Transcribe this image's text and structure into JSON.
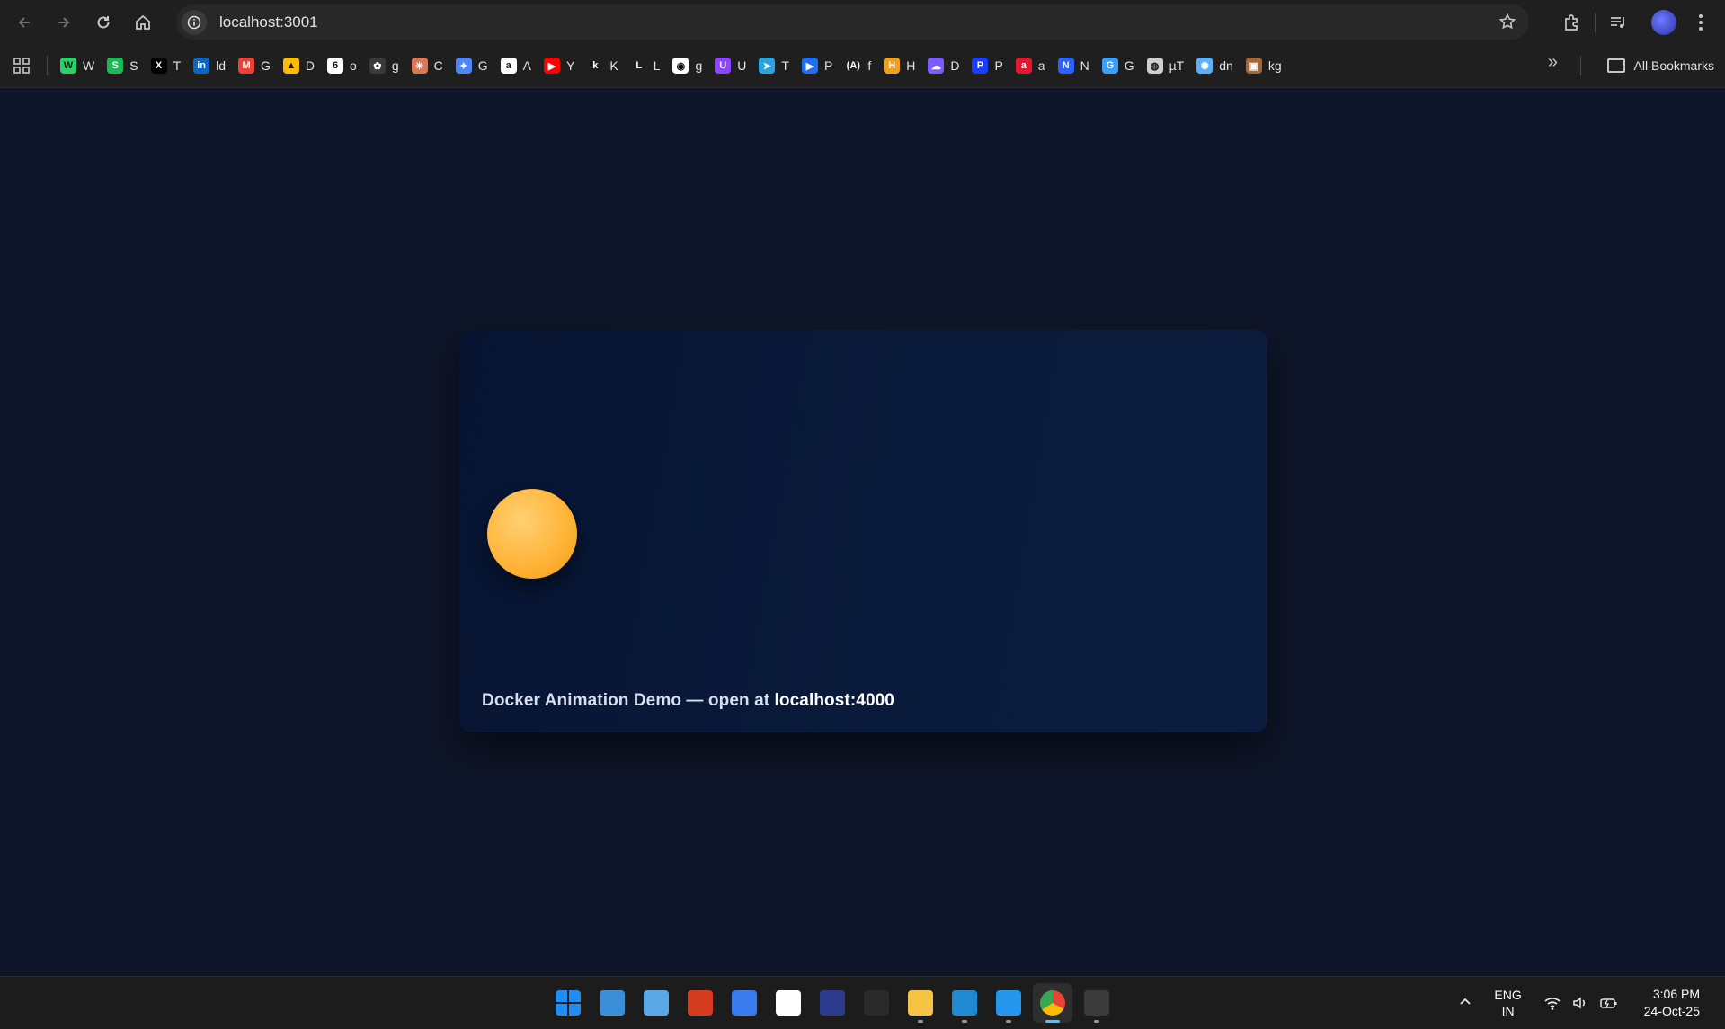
{
  "browser": {
    "url": "localhost:3001",
    "bookmarks": [
      {
        "label": "W",
        "icon": "whatsapp-icon",
        "color": "#25d366",
        "glyph": "W"
      },
      {
        "label": "S",
        "icon": "spotify-icon",
        "color": "#1db954",
        "glyph": "S"
      },
      {
        "label": "T",
        "icon": "x-twitter-icon",
        "color": "#000000",
        "glyph": "X"
      },
      {
        "label": "ld",
        "icon": "linkedin-icon",
        "color": "#0a66c2",
        "glyph": "in"
      },
      {
        "label": "G",
        "icon": "gmail-icon",
        "color": "#ea4335",
        "glyph": "M"
      },
      {
        "label": "D",
        "icon": "google-drive-icon",
        "color": "#fbbc04",
        "glyph": "▲"
      },
      {
        "label": "o",
        "icon": "six-icon",
        "color": "#ffffff",
        "glyph": "6"
      },
      {
        "label": "g",
        "icon": "openai-icon",
        "color": "#3a3a3a",
        "glyph": "✿"
      },
      {
        "label": "C",
        "icon": "claude-icon",
        "color": "#d97757",
        "glyph": "✳"
      },
      {
        "label": "G",
        "icon": "gemini-icon",
        "color": "#4f86f7",
        "glyph": "✦"
      },
      {
        "label": "A",
        "icon": "amazon-icon",
        "color": "#ffffff",
        "glyph": "a"
      },
      {
        "label": "Y",
        "icon": "youtube-icon",
        "color": "#ff0000",
        "glyph": "▶"
      },
      {
        "label": "K",
        "icon": "k-icon",
        "color": "#1f1f1f",
        "glyph": "k"
      },
      {
        "label": "L",
        "icon": "leetcode-icon",
        "color": "#1f1f1f",
        "glyph": "L"
      },
      {
        "label": "g",
        "icon": "github-icon",
        "color": "#ffffff",
        "glyph": "◉"
      },
      {
        "label": "U",
        "icon": "u-icon",
        "color": "#8e44ff",
        "glyph": "U"
      },
      {
        "label": "T",
        "icon": "telegram-icon",
        "color": "#2aa3df",
        "glyph": "➤"
      },
      {
        "label": "P",
        "icon": "play-icon",
        "color": "#1d6ff2",
        "glyph": "▶"
      },
      {
        "label": "f",
        "icon": "formula-icon",
        "color": "#1f1f1f",
        "glyph": "(A)"
      },
      {
        "label": "H",
        "icon": "h-icon",
        "color": "#f0a020",
        "glyph": "H"
      },
      {
        "label": "D",
        "icon": "cloud-icon",
        "color": "#7a5cff",
        "glyph": "☁"
      },
      {
        "label": "P",
        "icon": "p-icon",
        "color": "#1a3cff",
        "glyph": "P"
      },
      {
        "label": "a",
        "icon": "a-icon",
        "color": "#e0182d",
        "glyph": "a"
      },
      {
        "label": "N",
        "icon": "n-icon",
        "color": "#2b62ff",
        "glyph": "N"
      },
      {
        "label": "G",
        "icon": "g-icon",
        "color": "#3aa0ff",
        "glyph": "G"
      },
      {
        "label": "µT",
        "icon": "globe-icon",
        "color": "#cfcfcf",
        "glyph": "◍"
      },
      {
        "label": "dn",
        "icon": "dn-icon",
        "color": "#5ab0ff",
        "glyph": "✺"
      },
      {
        "label": "kg",
        "icon": "avatar-icon",
        "color": "#a0683a",
        "glyph": "▣"
      }
    ],
    "all_bookmarks_label": "All Bookmarks"
  },
  "page": {
    "caption_text": "Docker Animation Demo — open at ",
    "caption_strong": "localhost:4000"
  },
  "taskbar": {
    "apps": [
      {
        "icon": "windows-start-icon",
        "color": "#2b9af3"
      },
      {
        "icon": "photos-icon",
        "color": "#3b8fd8"
      },
      {
        "icon": "control-panel-icon",
        "color": "#5aa8e8"
      },
      {
        "icon": "shield-app-icon",
        "color": "#d43b1f"
      },
      {
        "icon": "blue-app-icon",
        "color": "#3a7bf0"
      },
      {
        "icon": "penguin-icon",
        "color": "#ffffff"
      },
      {
        "icon": "powershell-icon",
        "color": "#2d3b8f"
      },
      {
        "icon": "terminal-window-icon",
        "color": "#2a2a2a"
      },
      {
        "icon": "file-explorer-icon",
        "color": "#f6c443"
      },
      {
        "icon": "vscode-icon",
        "color": "#1f8ad2"
      },
      {
        "icon": "docker-icon",
        "color": "#2496ed"
      },
      {
        "icon": "chrome-icon",
        "color": "#4285f4"
      },
      {
        "icon": "terminal-icon",
        "color": "#3a3a3a"
      }
    ],
    "lang_line1": "ENG",
    "lang_line2": "IN",
    "time": "3:06 PM",
    "date": "24-Oct-25"
  }
}
